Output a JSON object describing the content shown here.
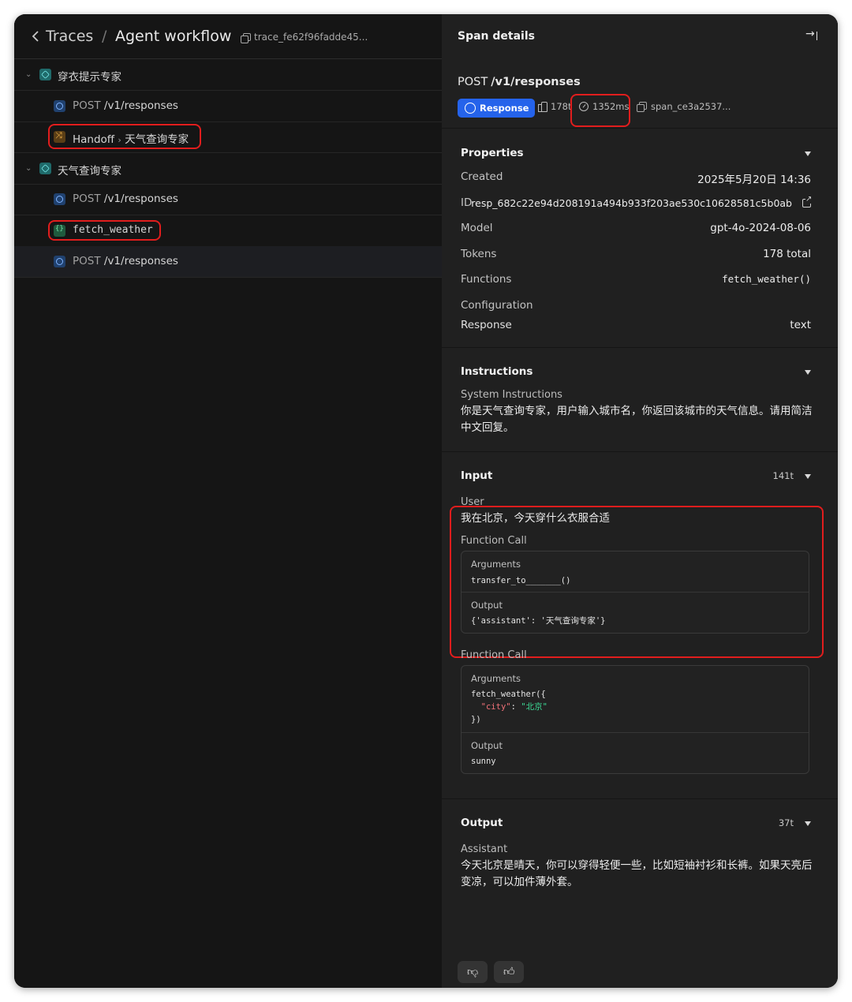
{
  "breadcrumb": {
    "root": "Traces",
    "separator": "/",
    "current": "Agent workflow",
    "trace_id": "trace_fe62f96fadde45..."
  },
  "tree": [
    {
      "kind": "agent",
      "label": "穿衣提示专家",
      "expanded": true
    },
    {
      "kind": "response",
      "method": "POST",
      "path": "/v1/responses"
    },
    {
      "kind": "handoff",
      "label": "Handoff",
      "arrow": "›",
      "target": "天气查询专家"
    },
    {
      "kind": "agent",
      "label": "天气查询专家",
      "expanded": true
    },
    {
      "kind": "response",
      "method": "POST",
      "path": "/v1/responses"
    },
    {
      "kind": "function",
      "label": "fetch_weather"
    },
    {
      "kind": "response",
      "method": "POST",
      "path": "/v1/responses",
      "selected": true
    }
  ],
  "panel": {
    "title": "Span details",
    "method": "POST",
    "path": "/v1/responses",
    "chip_response": "Response",
    "tokens": "178t",
    "duration": "1352ms",
    "span_id": "span_ce3a2537..."
  },
  "properties": {
    "title": "Properties",
    "rows": [
      {
        "key": "Created",
        "value": "2025年5月20日 14:36"
      },
      {
        "key": "ID",
        "value": "resp_682c22e94d208191a494b933f203ae530c10628581c5b0ab"
      },
      {
        "key": "Model",
        "value": "gpt-4o-2024-08-06"
      },
      {
        "key": "Tokens",
        "value": "178 total"
      },
      {
        "key": "Functions",
        "value": "fetch_weather()"
      },
      {
        "key": "Configuration",
        "value": ""
      },
      {
        "key": "Response",
        "value": "text"
      }
    ]
  },
  "instructions": {
    "title": "Instructions",
    "label": "System Instructions",
    "text": "你是天气查询专家，用户输入城市名，你返回该城市的天气信息。请用简洁中文回复。"
  },
  "input": {
    "title": "Input",
    "tokens": "141t",
    "user_label": "User",
    "user_text": "我在北京，今天穿什么衣服合适",
    "calls": [
      {
        "label": "Function Call",
        "args_label": "Arguments",
        "args": "transfer_to_______()",
        "output_label": "Output",
        "output": "{'assistant': '天气查询专家'}"
      },
      {
        "label": "Function Call",
        "args_label": "Arguments",
        "args_line1": "fetch_weather({",
        "args_key": "\"city\"",
        "args_colon": ": ",
        "args_val": "\"北京\"",
        "args_line3": "})",
        "output_label": "Output",
        "output": "sunny"
      }
    ]
  },
  "output": {
    "title": "Output",
    "tokens": "37t",
    "label": "Assistant",
    "text": "今天北京是晴天，你可以穿得轻便一些，比如短袖衬衫和长裤。如果天亮后变凉，可以加件薄外套。"
  },
  "feedback": {
    "down_icon": "thumbs-down-icon",
    "up_icon": "thumbs-up-icon"
  },
  "colors": {
    "accent": "#2563eb",
    "highlight": "#e11d1d",
    "panel_bg": "#202020",
    "sidebar_bg": "#151515"
  }
}
